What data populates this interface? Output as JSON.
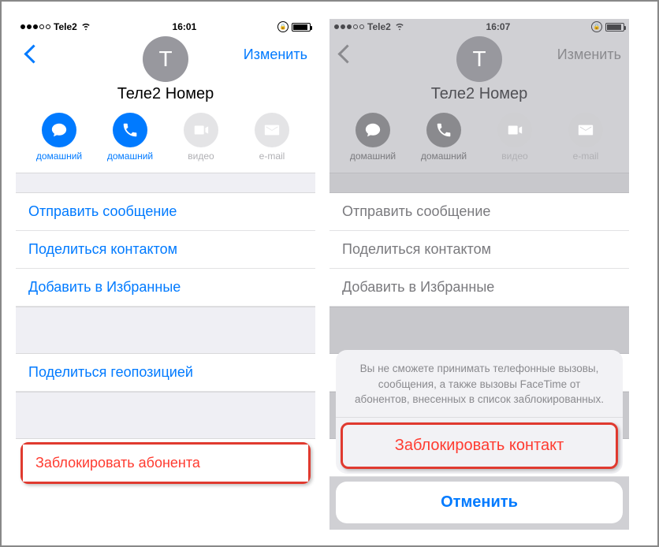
{
  "status": {
    "carrier": "Tele2",
    "time": "16:01",
    "time2": "16:07"
  },
  "nav": {
    "edit": "Изменить"
  },
  "contact": {
    "initial": "T",
    "name": "Теле2 Номер"
  },
  "actions": {
    "message": "домашний",
    "call": "домашний",
    "video": "видео",
    "email": "e-mail"
  },
  "list": {
    "send_message": "Отправить сообщение",
    "share_contact": "Поделиться контактом",
    "add_favorite": "Добавить в Избранные",
    "share_location": "Поделиться геопозицией",
    "block": "Заблокировать абонента"
  },
  "sheet": {
    "message": "Вы не сможете принимать телефонные вызовы, сообщения, а также вызовы FaceTime от абонентов, внесенных в список заблокированных.",
    "block_contact": "Заблокировать контакт",
    "cancel": "Отменить"
  }
}
